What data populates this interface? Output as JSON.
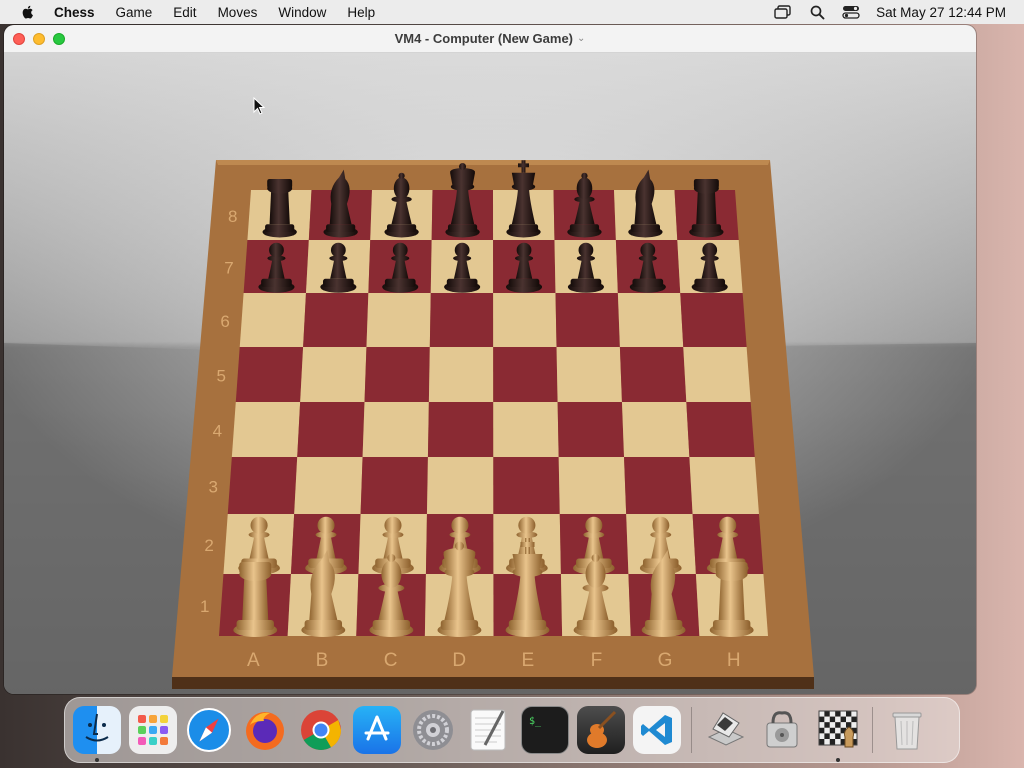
{
  "menubar": {
    "items": [
      "Chess",
      "Game",
      "Edit",
      "Moves",
      "Window",
      "Help"
    ],
    "clock": "Sat May 27  12:44 PM"
  },
  "window": {
    "title": "VM4 - Computer   (New Game)"
  },
  "board": {
    "ranks": [
      "8",
      "7",
      "6",
      "5",
      "4",
      "3",
      "2",
      "1"
    ],
    "files": [
      "A",
      "B",
      "C",
      "D",
      "E",
      "F",
      "G",
      "H"
    ],
    "dark_square": "#8a2a33",
    "light_square": "#e3c892",
    "frame_color": "#9c6a3c",
    "black_piece": "#2a1a16",
    "white_piece": "#c99b5c",
    "back_rank": [
      "rook",
      "knight",
      "bishop",
      "queen",
      "king",
      "bishop",
      "knight",
      "rook"
    ]
  },
  "dock": {
    "apps": [
      "finder-icon",
      "launchpad-icon",
      "safari-icon",
      "firefox-icon",
      "chrome-icon",
      "app-store-icon",
      "system-settings-icon",
      "textedit-icon",
      "terminal-icon",
      "garageband-icon",
      "vscode-icon"
    ],
    "recent": [
      "installer-icon",
      "disk-utility-icon",
      "chess-icon"
    ],
    "trash": "trash-icon"
  }
}
